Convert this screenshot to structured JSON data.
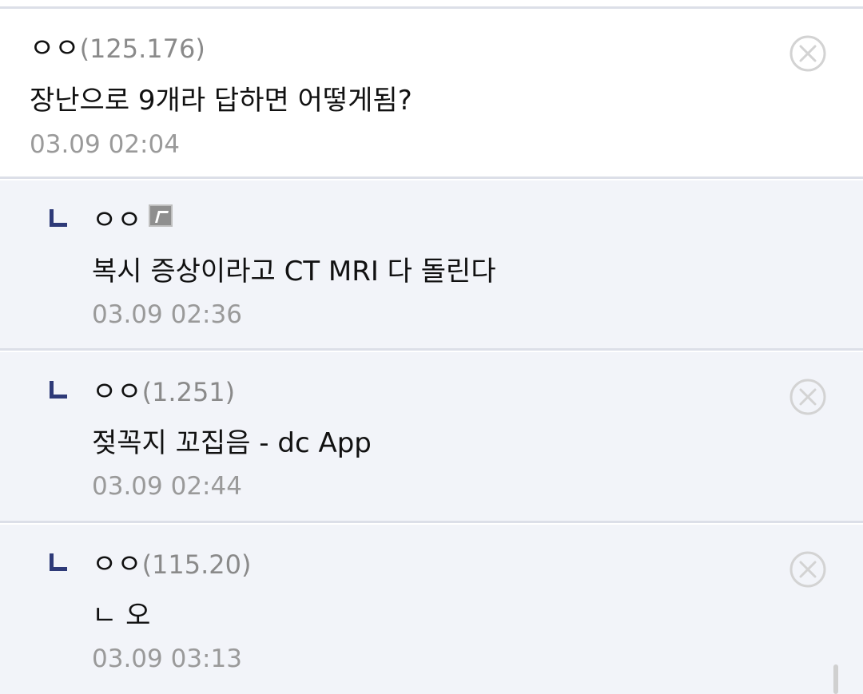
{
  "comments": [
    {
      "author": "ㅇㅇ",
      "ip": "(125.176)",
      "text": "장난으로 9개라 답하면 어떻게됨?",
      "time": "03.09 02:04",
      "is_reply": false,
      "deletable": true
    },
    {
      "author": "ㅇㅇ",
      "ip": "",
      "text": "복시 증상이라고 CT MRI 다 돌린다",
      "time": "03.09 02:36",
      "is_reply": true,
      "has_fixed_nick_badge": true,
      "deletable": false
    },
    {
      "author": "ㅇㅇ",
      "ip": "(1.251)",
      "text": "젖꼭지 꼬집음 - dc App",
      "time": "03.09 02:44",
      "is_reply": true,
      "deletable": true
    },
    {
      "author": "ㅇㅇ",
      "ip": "(115.20)",
      "text": "ㄴ 오",
      "time": "03.09 03:13",
      "is_reply": true,
      "deletable": true
    }
  ],
  "icons": {
    "reply": "reply-arrow-icon",
    "delete": "close-circle-icon",
    "badge": "fixed-nick-badge-icon"
  },
  "colors": {
    "reply_background": "#f2f4f9",
    "divider": "#dcdfe8",
    "reply_mark": "#2e3a78",
    "meta_text": "#9a9a9a"
  }
}
